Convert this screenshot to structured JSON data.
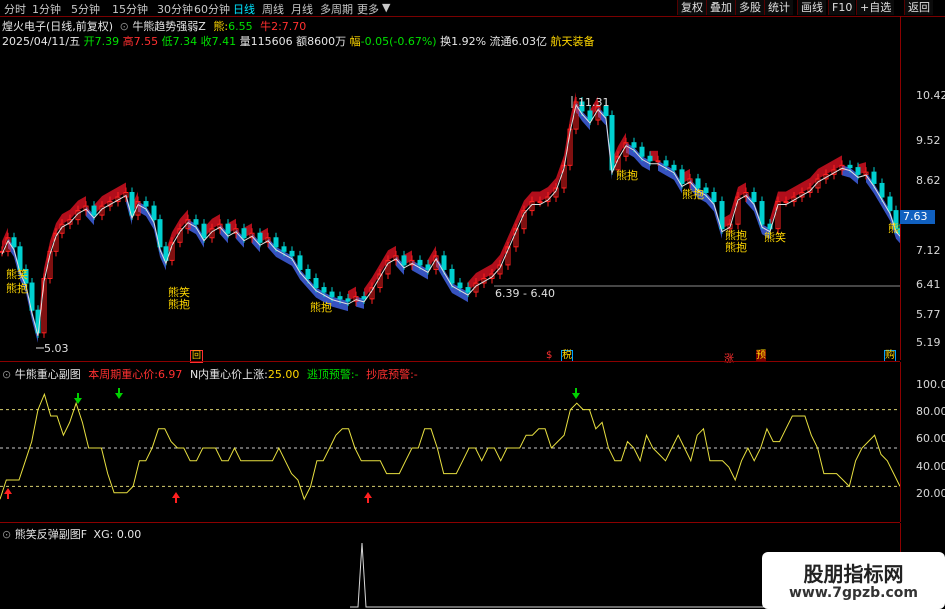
{
  "toolbar": {
    "timeframes": [
      "分时",
      "1分钟",
      "5分钟",
      "15分钟",
      "30分钟",
      "60分钟",
      "日线",
      "周线",
      "月线",
      "多周期",
      "更多"
    ],
    "active": "日线",
    "buttons": [
      "复权",
      "叠加",
      "多股",
      "统计",
      "画线",
      "F10",
      "+自选",
      "返回"
    ]
  },
  "header": {
    "stock": "煌火电子(日线,前复权)",
    "indicator_name": "牛熊趋势强弱Z",
    "bear_label": "熊:",
    "bear_value": "6.55",
    "bull_label": "牛2:",
    "bull_value": "7.70",
    "date": "2025/04/11/五",
    "open_label": "开",
    "open": "7.39",
    "high_label": "高",
    "high": "7.55",
    "low_label": "低",
    "low": "7.34",
    "close_label": "收",
    "close": "7.41",
    "volume_label": "量",
    "volume": "115606",
    "amount_label": "额",
    "amount": "8600万",
    "change_label": "幅",
    "change": "-0.05(-0.67%)",
    "turnover_label": "换",
    "turnover": "1.92%",
    "float_label": "流通",
    "float": "6.03亿",
    "sector": "航天装备"
  },
  "price_axis": [
    "10.42",
    "9.52",
    "8.62",
    "7.63",
    "7.12",
    "6.41",
    "5.77",
    "5.19"
  ],
  "current_price": "7.63",
  "annotations": {
    "high": "11.31",
    "low": "5.03",
    "range": "6.39 - 6.40",
    "bear_hug": "熊抱",
    "bear_smile": "熊笑",
    "event_tags": [
      "回",
      "$",
      "税",
      "涨",
      "预",
      "购"
    ]
  },
  "sub1": {
    "title": "牛熊重心副图",
    "weekly_label": "本周期重心价:",
    "weekly_value": "6.97",
    "n_label": "N内重心价上涨:",
    "n_value": "25.00",
    "escape_label": "逃顶预警:",
    "escape_value": "-",
    "bottom_label": "抄底预警:",
    "bottom_value": "-",
    "axis": [
      "100.0",
      "80.00",
      "60.00",
      "40.00",
      "20.00"
    ]
  },
  "chart_data": {
    "type": "line",
    "title": "牛熊重心副图",
    "ylim": [
      0,
      100
    ],
    "levels": [
      20,
      50,
      80
    ],
    "values": [
      10,
      25,
      25,
      25,
      40,
      55,
      80,
      92,
      75,
      75,
      60,
      70,
      85,
      70,
      50,
      50,
      50,
      30,
      15,
      15,
      15,
      20,
      40,
      40,
      50,
      65,
      65,
      55,
      50,
      50,
      40,
      40,
      50,
      50,
      50,
      40,
      40,
      50,
      40,
      40,
      40,
      40,
      40,
      40,
      50,
      40,
      30,
      25,
      10,
      20,
      40,
      40,
      50,
      60,
      65,
      65,
      50,
      40,
      40,
      40,
      40,
      30,
      30,
      30,
      40,
      50,
      50,
      65,
      65,
      50,
      30,
      30,
      30,
      40,
      50,
      50,
      40,
      50,
      50,
      40,
      50,
      50,
      50,
      60,
      60,
      65,
      65,
      50,
      55,
      60,
      80,
      85,
      80,
      80,
      65,
      70,
      50,
      40,
      40,
      55,
      50,
      40,
      60,
      50,
      45,
      40,
      50,
      60,
      50,
      40,
      60,
      65,
      40,
      40,
      40,
      35,
      25,
      40,
      50,
      40,
      50,
      65,
      55,
      55,
      65,
      75,
      75,
      75,
      60,
      50,
      30,
      30,
      30,
      25,
      20,
      40,
      50,
      55,
      60,
      45,
      40,
      30,
      20
    ]
  },
  "sub2": {
    "title": "熊笑反弹副图F",
    "xg_label": "XG:",
    "xg_value": "0.00"
  },
  "watermark": {
    "line1": "股朋指标网",
    "line2": "www.7gpzb.com"
  }
}
